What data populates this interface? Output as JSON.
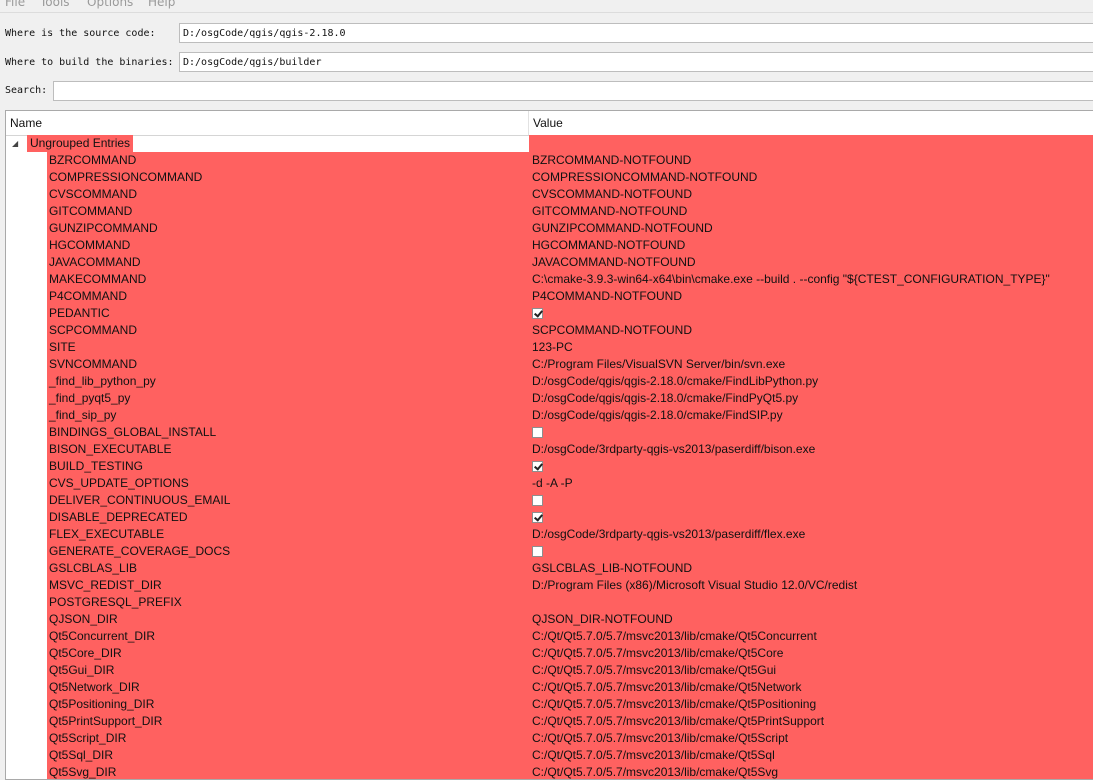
{
  "menu": [
    "File",
    "Tools",
    "Options",
    "Help"
  ],
  "source": {
    "label": "Where is the source code:",
    "value": "D:/osgCode/qgis/qgis-2.18.0"
  },
  "build": {
    "label": "Where to build the binaries:",
    "value": "D:/osgCode/qgis/builder"
  },
  "search": {
    "label": "Search:",
    "value": ""
  },
  "table": {
    "headers": {
      "name": "Name",
      "value": "Value"
    },
    "group": "Ungrouped Entries",
    "highlight_color": "#ff6160",
    "entries": [
      {
        "name": "BZRCOMMAND",
        "type": "text",
        "value": "BZRCOMMAND-NOTFOUND"
      },
      {
        "name": "COMPRESSIONCOMMAND",
        "type": "text",
        "value": "COMPRESSIONCOMMAND-NOTFOUND"
      },
      {
        "name": "CVSCOMMAND",
        "type": "text",
        "value": "CVSCOMMAND-NOTFOUND"
      },
      {
        "name": "GITCOMMAND",
        "type": "text",
        "value": "GITCOMMAND-NOTFOUND"
      },
      {
        "name": "GUNZIPCOMMAND",
        "type": "text",
        "value": "GUNZIPCOMMAND-NOTFOUND"
      },
      {
        "name": "HGCOMMAND",
        "type": "text",
        "value": "HGCOMMAND-NOTFOUND"
      },
      {
        "name": "JAVACOMMAND",
        "type": "text",
        "value": "JAVACOMMAND-NOTFOUND"
      },
      {
        "name": "MAKECOMMAND",
        "type": "text",
        "value": "C:\\cmake-3.9.3-win64-x64\\bin\\cmake.exe --build . --config \"${CTEST_CONFIGURATION_TYPE}\""
      },
      {
        "name": "P4COMMAND",
        "type": "text",
        "value": "P4COMMAND-NOTFOUND"
      },
      {
        "name": "PEDANTIC",
        "type": "bool",
        "checked": true
      },
      {
        "name": "SCPCOMMAND",
        "type": "text",
        "value": "SCPCOMMAND-NOTFOUND"
      },
      {
        "name": "SITE",
        "type": "text",
        "value": "123-PC"
      },
      {
        "name": "SVNCOMMAND",
        "type": "text",
        "value": "C:/Program Files/VisualSVN Server/bin/svn.exe"
      },
      {
        "name": "_find_lib_python_py",
        "type": "text",
        "value": "D:/osgCode/qgis/qgis-2.18.0/cmake/FindLibPython.py"
      },
      {
        "name": "_find_pyqt5_py",
        "type": "text",
        "value": "D:/osgCode/qgis/qgis-2.18.0/cmake/FindPyQt5.py"
      },
      {
        "name": "_find_sip_py",
        "type": "text",
        "value": "D:/osgCode/qgis/qgis-2.18.0/cmake/FindSIP.py"
      },
      {
        "name": "BINDINGS_GLOBAL_INSTALL",
        "type": "bool",
        "checked": false
      },
      {
        "name": "BISON_EXECUTABLE",
        "type": "text",
        "value": "D:/osgCode/3rdparty-qgis-vs2013/paserdiff/bison.exe"
      },
      {
        "name": "BUILD_TESTING",
        "type": "bool",
        "checked": true
      },
      {
        "name": "CVS_UPDATE_OPTIONS",
        "type": "text",
        "value": "-d -A -P"
      },
      {
        "name": "DELIVER_CONTINUOUS_EMAIL",
        "type": "bool",
        "checked": false
      },
      {
        "name": "DISABLE_DEPRECATED",
        "type": "bool",
        "checked": true
      },
      {
        "name": "FLEX_EXECUTABLE",
        "type": "text",
        "value": "D:/osgCode/3rdparty-qgis-vs2013/paserdiff/flex.exe"
      },
      {
        "name": "GENERATE_COVERAGE_DOCS",
        "type": "bool",
        "checked": false
      },
      {
        "name": "GSLCBLAS_LIB",
        "type": "text",
        "value": "GSLCBLAS_LIB-NOTFOUND"
      },
      {
        "name": "MSVC_REDIST_DIR",
        "type": "text",
        "value": "D:/Program Files (x86)/Microsoft Visual Studio 12.0/VC/redist"
      },
      {
        "name": "POSTGRESQL_PREFIX",
        "type": "text",
        "value": ""
      },
      {
        "name": "QJSON_DIR",
        "type": "text",
        "value": "QJSON_DIR-NOTFOUND"
      },
      {
        "name": "Qt5Concurrent_DIR",
        "type": "text",
        "value": "C:/Qt/Qt5.7.0/5.7/msvc2013/lib/cmake/Qt5Concurrent"
      },
      {
        "name": "Qt5Core_DIR",
        "type": "text",
        "value": "C:/Qt/Qt5.7.0/5.7/msvc2013/lib/cmake/Qt5Core"
      },
      {
        "name": "Qt5Gui_DIR",
        "type": "text",
        "value": "C:/Qt/Qt5.7.0/5.7/msvc2013/lib/cmake/Qt5Gui"
      },
      {
        "name": "Qt5Network_DIR",
        "type": "text",
        "value": "C:/Qt/Qt5.7.0/5.7/msvc2013/lib/cmake/Qt5Network"
      },
      {
        "name": "Qt5Positioning_DIR",
        "type": "text",
        "value": "C:/Qt/Qt5.7.0/5.7/msvc2013/lib/cmake/Qt5Positioning"
      },
      {
        "name": "Qt5PrintSupport_DIR",
        "type": "text",
        "value": "C:/Qt/Qt5.7.0/5.7/msvc2013/lib/cmake/Qt5PrintSupport"
      },
      {
        "name": "Qt5Script_DIR",
        "type": "text",
        "value": "C:/Qt/Qt5.7.0/5.7/msvc2013/lib/cmake/Qt5Script"
      },
      {
        "name": "Qt5Sql_DIR",
        "type": "text",
        "value": "C:/Qt/Qt5.7.0/5.7/msvc2013/lib/cmake/Qt5Sql"
      },
      {
        "name": "Qt5Svg_DIR",
        "type": "text",
        "value": "C:/Qt/Qt5.7.0/5.7/msvc2013/lib/cmake/Qt5Svg"
      }
    ]
  }
}
